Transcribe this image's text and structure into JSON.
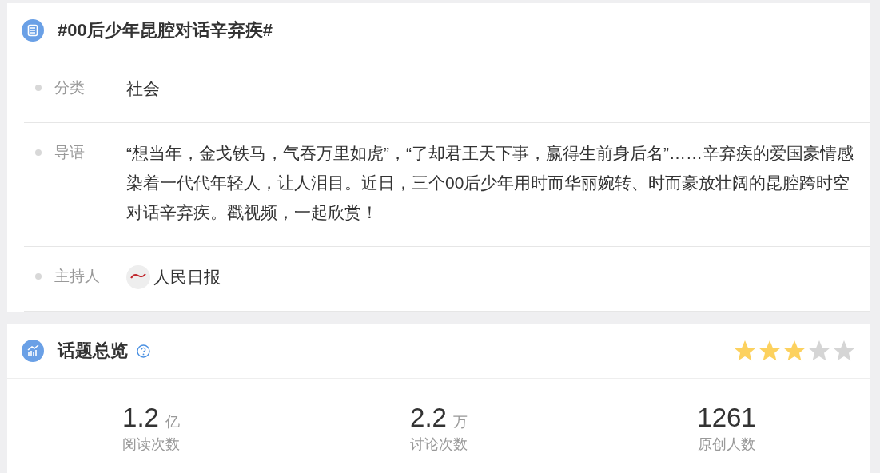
{
  "topic": {
    "title": "#00后少年昆腔对话辛弃疾#",
    "fields": [
      {
        "label": "分类",
        "value": "社会"
      },
      {
        "label": "导语",
        "value": "“想当年，金戈铁马，气吞万里如虎”，“了却君王天下事，赢得生前身后名”……辛弃疾的爱国豪情感染着一代代年轻人，让人泪目。近日，三个00后少年用时而华丽婉转、时而豪放壮阔的昆腔跨时空对话辛弃疾。戳视频，一起欣赏！"
      },
      {
        "label": "主持人",
        "value": "人民日报",
        "kind": "host"
      }
    ]
  },
  "overview": {
    "title": "话题总览",
    "stars": 3,
    "stats": [
      {
        "number": "1.2",
        "unit": "亿",
        "label": "阅读次数"
      },
      {
        "number": "2.2",
        "unit": "万",
        "label": "讨论次数"
      },
      {
        "number": "1261",
        "label": "原创人数"
      }
    ]
  }
}
